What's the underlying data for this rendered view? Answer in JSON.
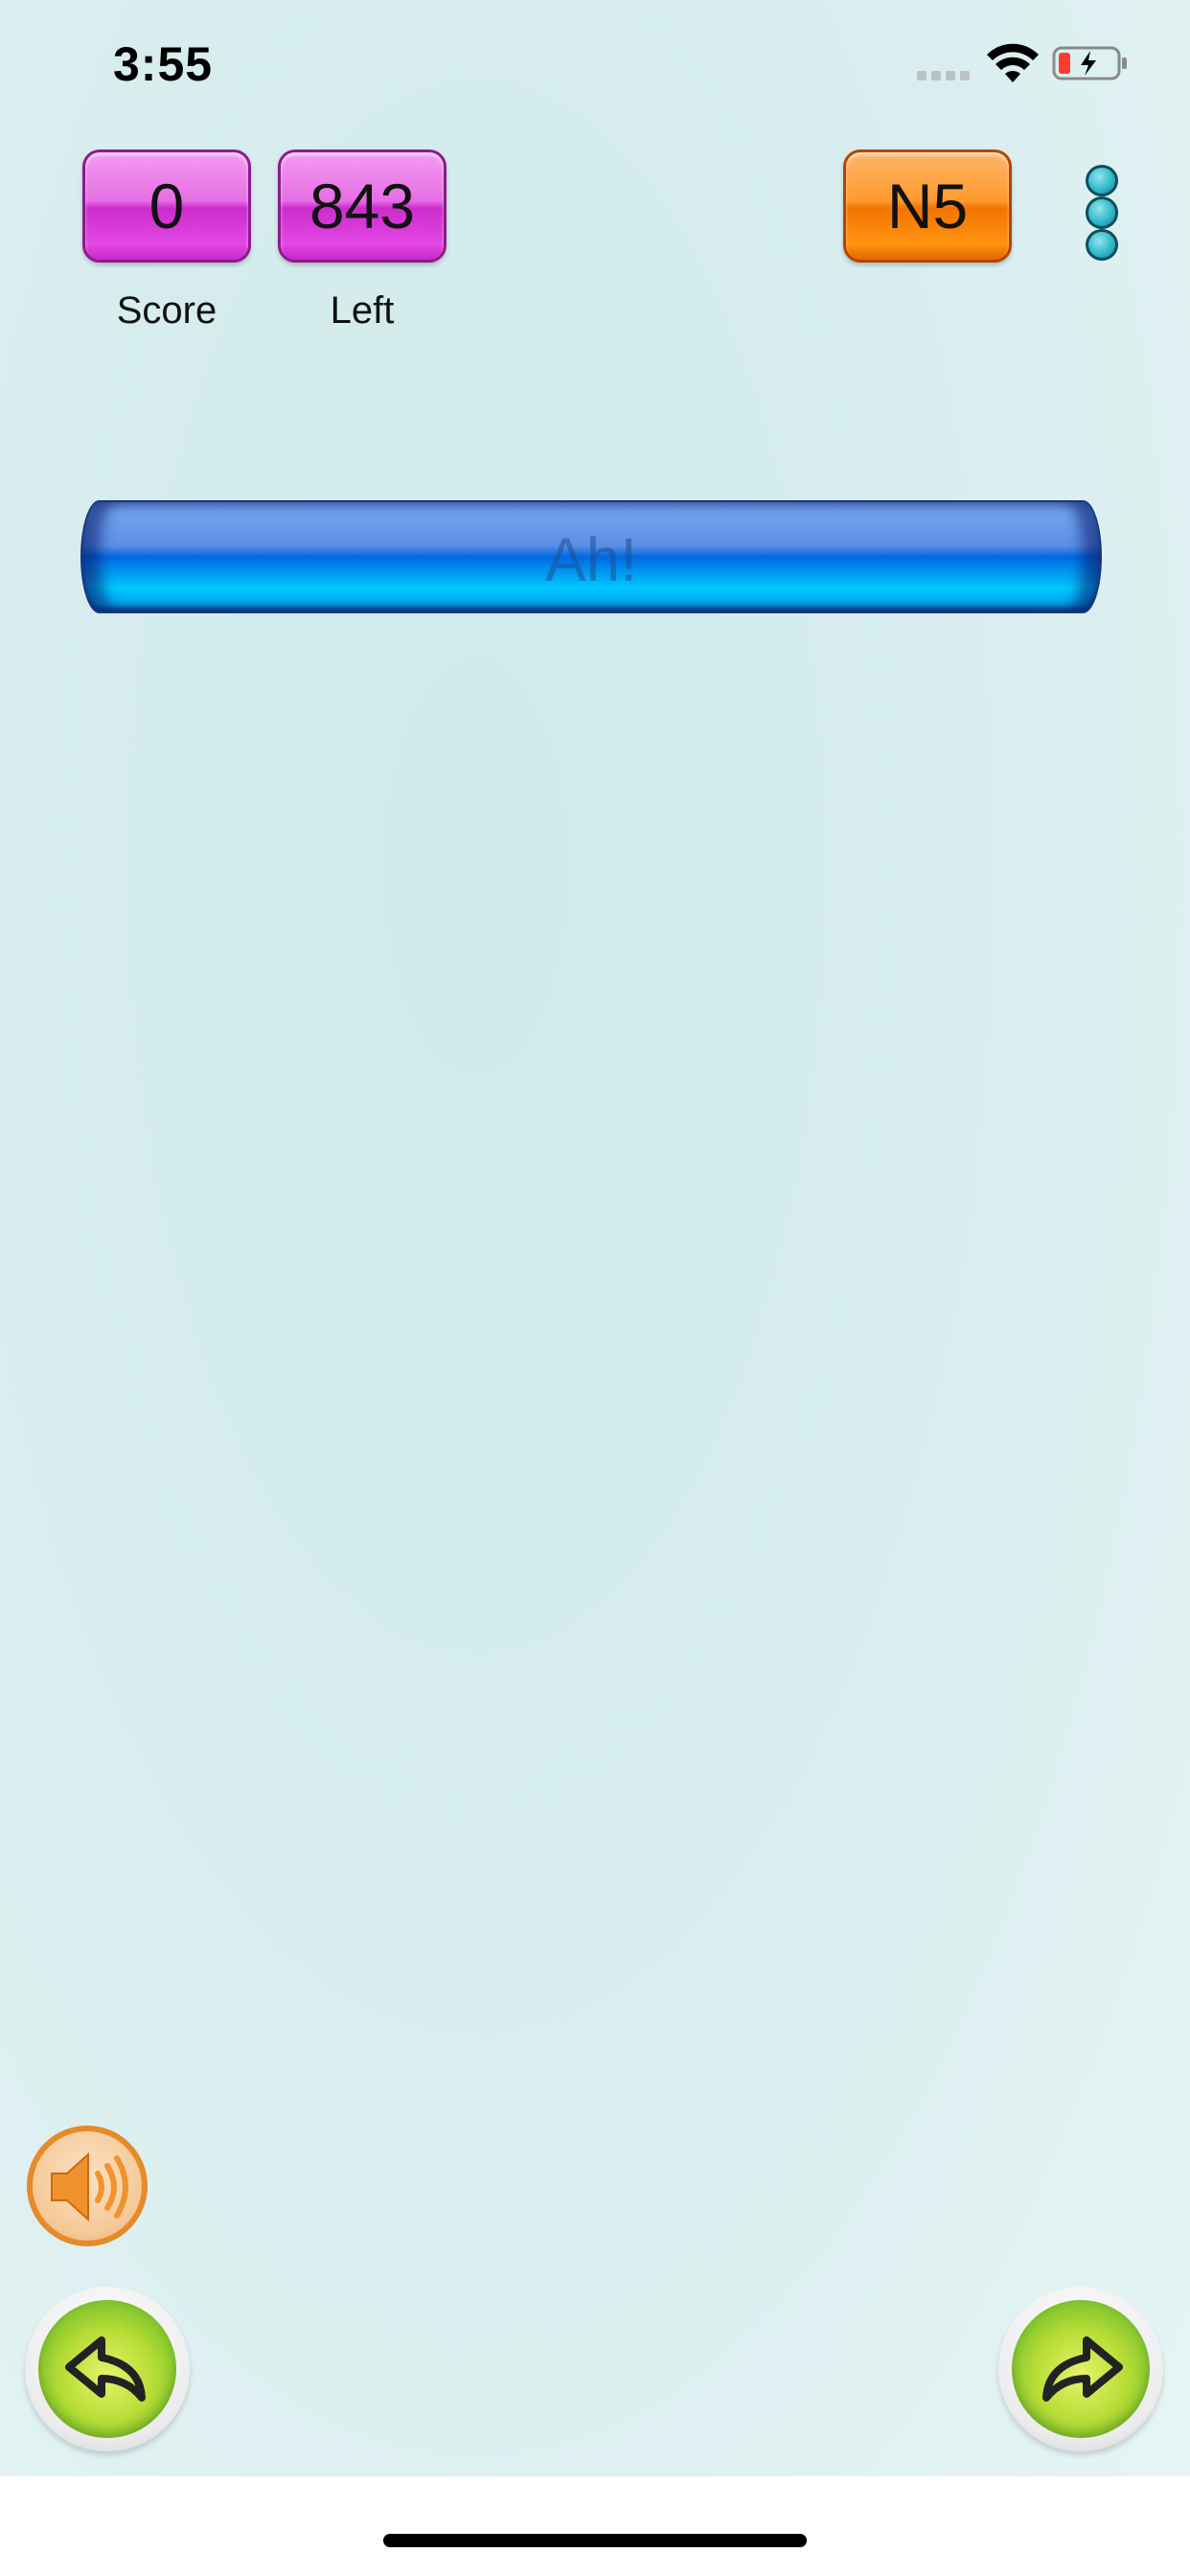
{
  "status_bar": {
    "time": "3:55"
  },
  "header": {
    "score": {
      "value": "0",
      "label": "Score"
    },
    "left": {
      "value": "843",
      "label": "Left"
    },
    "level": {
      "value": "N5"
    }
  },
  "answer_bar": {
    "text": "Ah!"
  },
  "icons": {
    "menu": "more-vertical-icon",
    "sound": "speaker-icon",
    "back": "undo-arrow-icon",
    "forward": "redo-arrow-icon"
  },
  "colors": {
    "badge_magenta": "#e247e2",
    "badge_orange": "#ff9410",
    "answer_bar": "#0068e0",
    "nav_green": "#b7dd36",
    "sound_orange": "#e68a2a"
  }
}
